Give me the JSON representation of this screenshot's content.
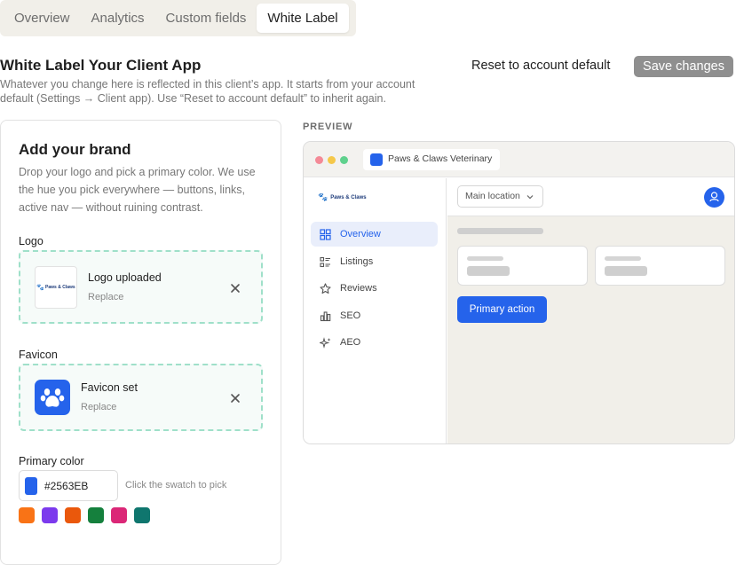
{
  "tabs": [
    {
      "label": "Overview"
    },
    {
      "label": "Analytics"
    },
    {
      "label": "Custom fields"
    },
    {
      "label": "White Label"
    }
  ],
  "header": {
    "title": "White Label Your Client App",
    "description": "Whatever you change here is reflected in this client’s app. It starts from your account default (Settings → Client app). Use “Reset to account default” to inherit again.",
    "reset_label": "Reset to account default",
    "save_label": "Save changes"
  },
  "brand": {
    "title": "Add your brand",
    "description": "Drop your logo and pick a primary color. We use the hue you pick everywhere — buttons, links, active nav — without ruining contrast.",
    "logo": {
      "label": "Logo",
      "status": "Logo uploaded",
      "action": "Replace",
      "thumb_text": "Paws & Claws"
    },
    "favicon": {
      "label": "Favicon",
      "status": "Favicon set",
      "action": "Replace"
    },
    "primary_color": {
      "label": "Primary color",
      "value": "#2563EB",
      "hint": "Click the swatch to pick",
      "presets": [
        "#F97316",
        "#7C3AED",
        "#EA580C",
        "#15803D",
        "#DB2777",
        "#0F766E"
      ]
    }
  },
  "preview": {
    "label": "PREVIEW",
    "tab_title": "Paws & Claws Veterinary",
    "brand_name": "Paws & Claws",
    "nav": [
      {
        "label": "Overview",
        "icon": "grid-icon",
        "active": true
      },
      {
        "label": "Listings",
        "icon": "list-icon",
        "active": false
      },
      {
        "label": "Reviews",
        "icon": "star-icon",
        "active": false
      },
      {
        "label": "SEO",
        "icon": "bar-chart-icon",
        "active": false
      },
      {
        "label": "AEO",
        "icon": "sparkle-icon",
        "active": false
      }
    ],
    "location_select": "Main location",
    "primary_action": "Primary action",
    "accent": "#2563EB"
  }
}
